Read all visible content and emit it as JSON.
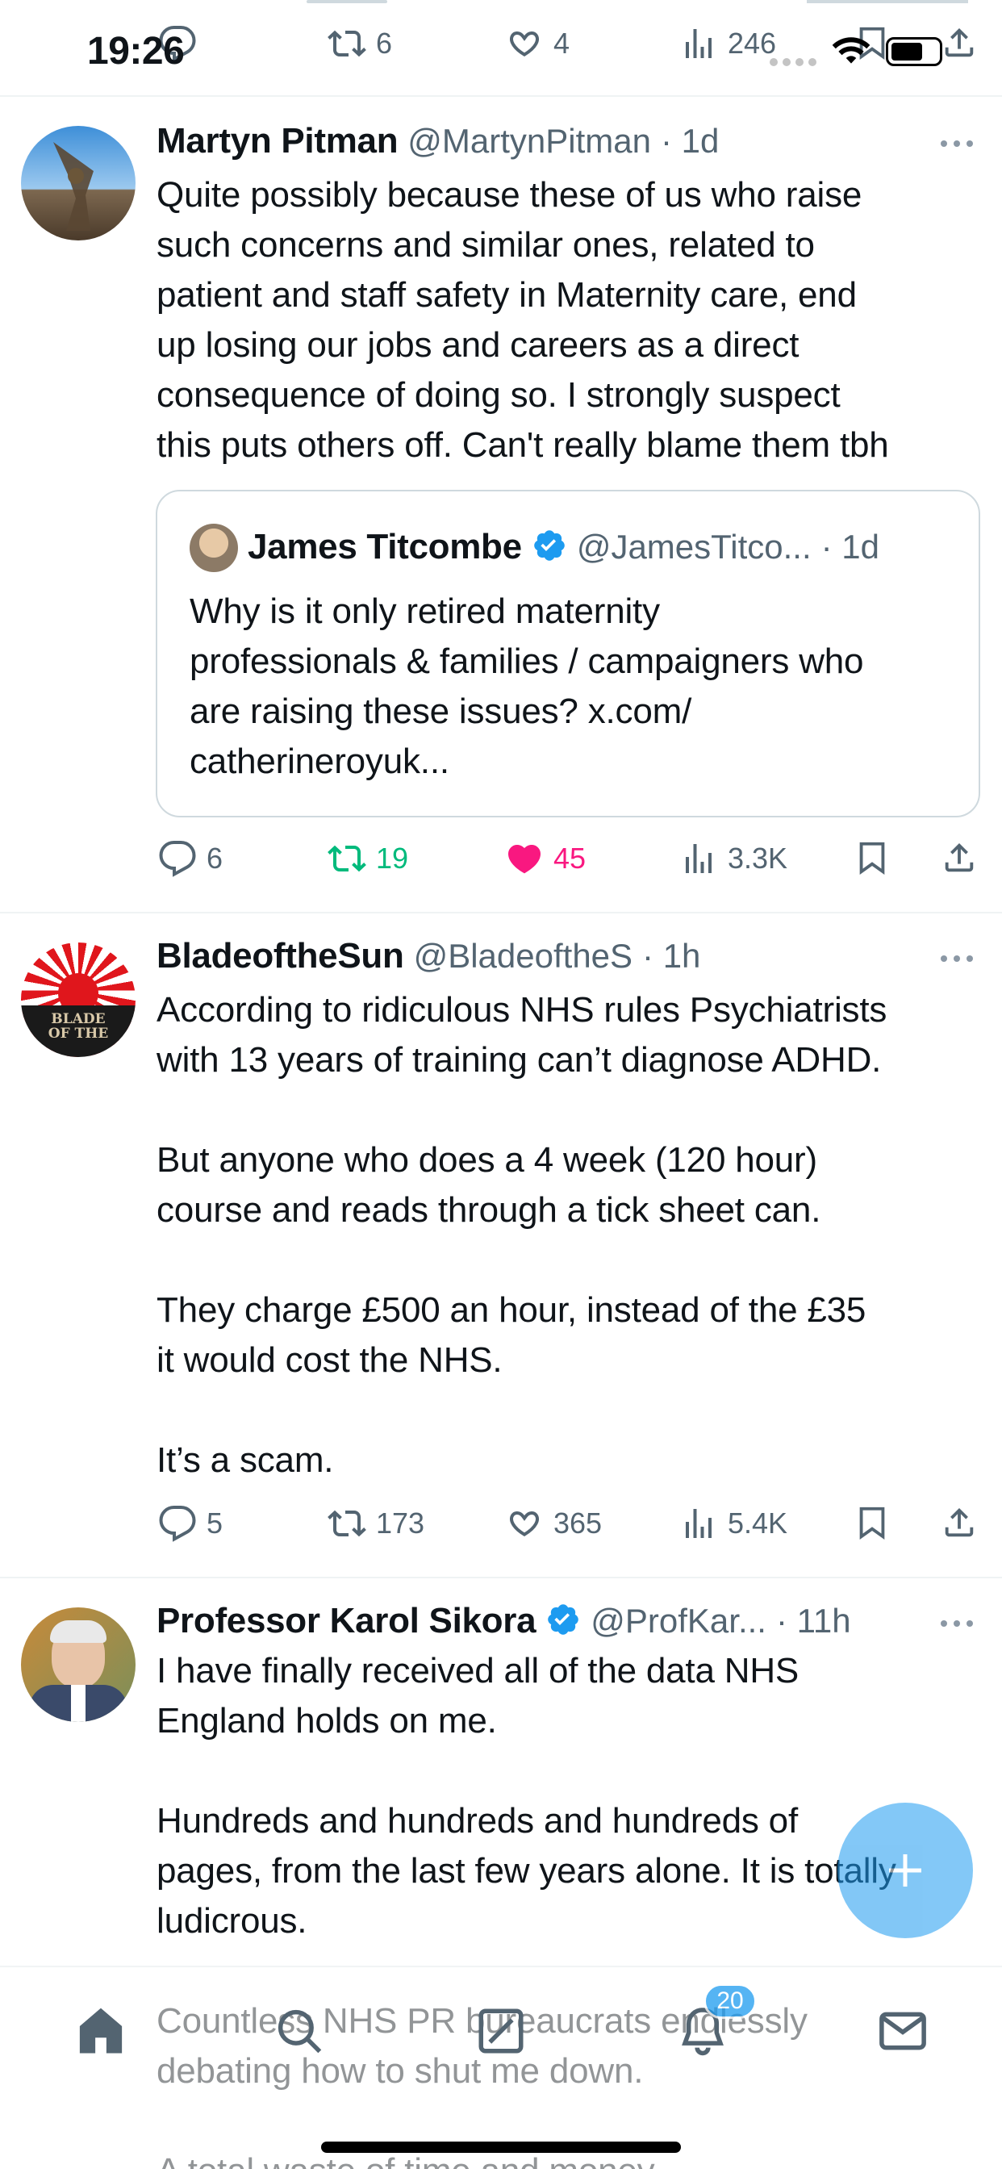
{
  "status": {
    "time": "19:26"
  },
  "top_actions": {
    "replies": "",
    "reposts": "6",
    "likes": "4",
    "views": "246"
  },
  "tweets": [
    {
      "name": "Martyn Pitman",
      "handle": "@MartynPitman",
      "time": "· 1d",
      "text": "Quite possibly because these of us who raise\nsuch concerns and similar ones, related to\npatient and staff safety in Maternity care, end\nup losing our jobs and careers as a direct\nconsequence of doing so. I strongly suspect\nthis puts others off. Can't really blame them tbh",
      "quote": {
        "name": "James Titcombe",
        "handle": "@JamesTitco...",
        "time": "· 1d",
        "text": "Why is it only retired maternity\nprofessionals & families / campaigners who\nare raising these issues? x.com/\ncatherineroyuk..."
      },
      "replies": "6",
      "reposts": "19",
      "likes": "45",
      "views": "3.3K"
    },
    {
      "name": "BladeoftheSun",
      "handle": "@BladeoftheS",
      "time": "· 1h",
      "avatar_text": "BLADE\nOF THE",
      "text": "According to ridiculous NHS rules Psychiatrists\nwith 13 years of training can’t diagnose ADHD.\n\nBut anyone who does a 4 week (120 hour)\ncourse and reads through a tick sheet can.\n\nThey charge £500 an hour, instead of the £35\nit would cost the NHS.\n\nIt’s a scam.",
      "replies": "5",
      "reposts": "173",
      "likes": "365",
      "views": "5.4K"
    },
    {
      "name": "Professor Karol Sikora",
      "handle": "@ProfKar...",
      "time": "· 11h",
      "text": "I have finally received all of the data NHS\nEngland holds on me.\n\nHundreds and hundreds and hundreds of\npages, from the last few years alone. It is totally\nludicrous.\n\nCountless NHS PR bureaucrats endlessly\ndebating how to shut me down.\n\nA total waste of time and money."
    }
  ],
  "nav": {
    "notifications_badge": "20"
  },
  "colors": {
    "accent": "#1d9bf0",
    "repost": "#00ba7c",
    "like": "#f91880",
    "fab": "#1d9bf0"
  }
}
